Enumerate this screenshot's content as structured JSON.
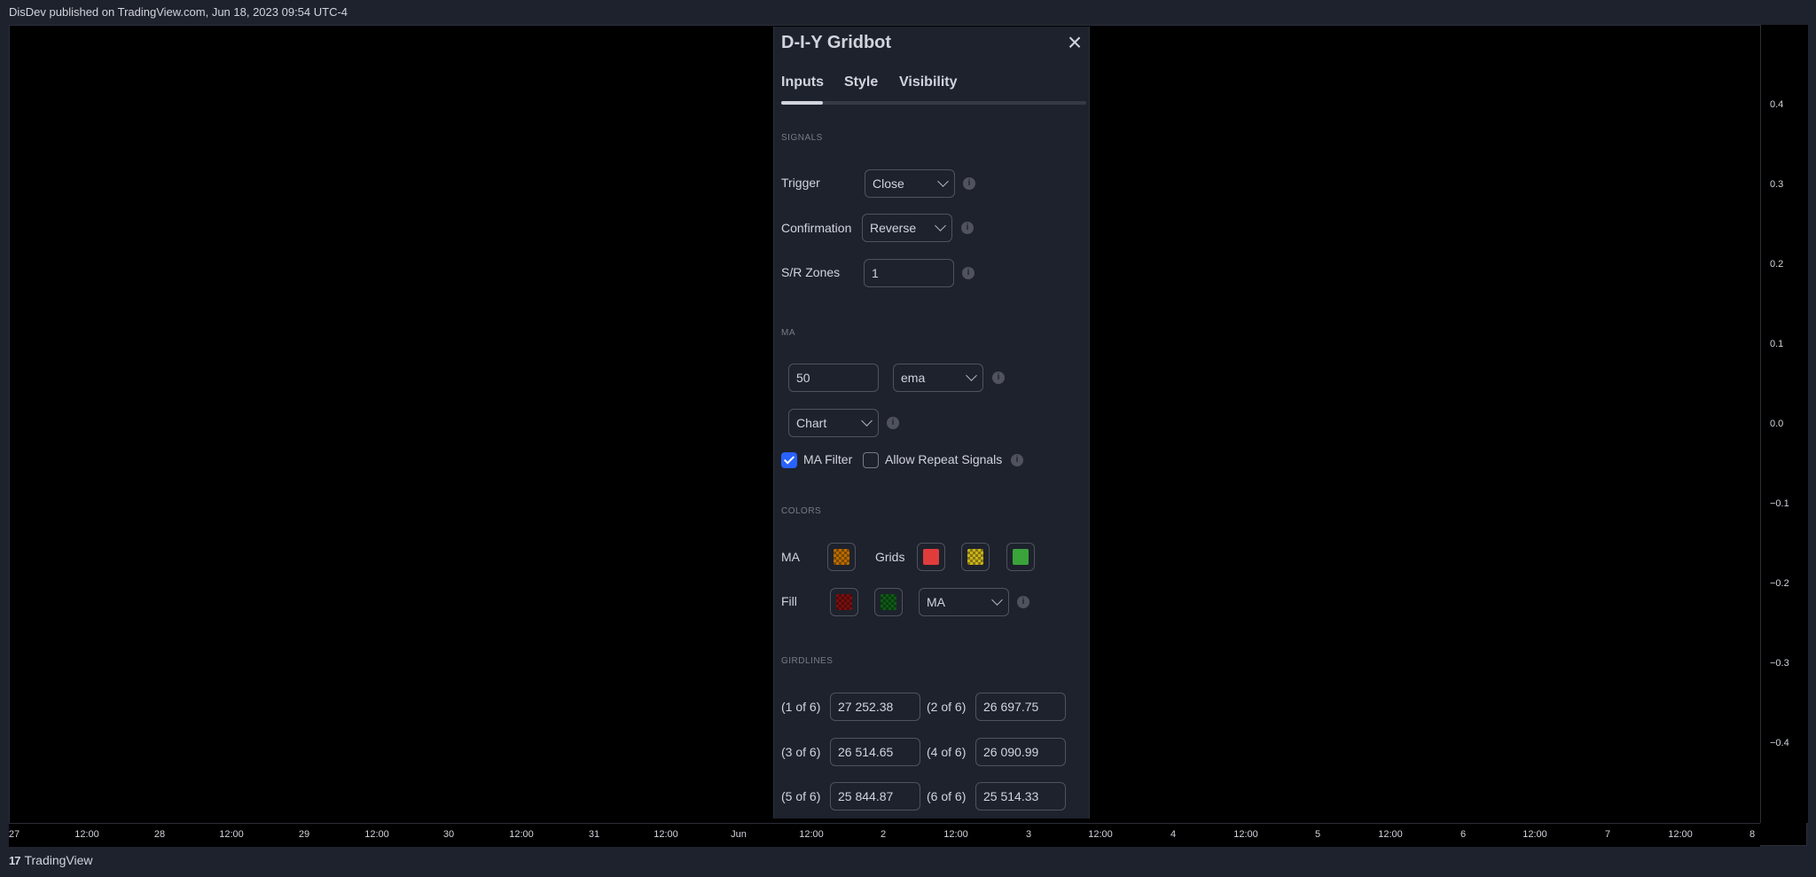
{
  "header": {
    "text": "DisDev published on TradingView.com, Jun 18, 2023 09:54 UTC-4"
  },
  "price_axis": {
    "ticks": [
      "0.4",
      "0.3",
      "0.2",
      "0.1",
      "0.0",
      "−0.1",
      "−0.2",
      "−0.3",
      "−0.4"
    ]
  },
  "time_axis": {
    "ticks": [
      "27",
      "12:00",
      "28",
      "12:00",
      "29",
      "12:00",
      "30",
      "12:00",
      "31",
      "12:00",
      "Jun",
      "12:00",
      "2",
      "12:00",
      "3",
      "12:00",
      "4",
      "12:00",
      "5",
      "12:00",
      "6",
      "12:00",
      "7",
      "12:00",
      "8"
    ]
  },
  "footer": {
    "logo": "17",
    "brand": "TradingView"
  },
  "dialog": {
    "title": "D-I-Y Gridbot",
    "close_icon": "×",
    "tabs": [
      {
        "label": "Inputs",
        "active": true
      },
      {
        "label": "Style"
      },
      {
        "label": "Visibility"
      }
    ],
    "signals": {
      "section": "SIGNALS",
      "trigger_label": "Trigger",
      "trigger_value": "Close",
      "confirmation_label": "Confirmation",
      "confirmation_value": "Reverse",
      "sr_label": "S/R Zones",
      "sr_value": "1"
    },
    "ma": {
      "section": "MA",
      "length": "50",
      "type": "ema",
      "source": "Chart",
      "ma_filter_label": "MA Filter",
      "ma_filter_checked": true,
      "allow_repeat_label": "Allow Repeat Signals",
      "allow_repeat_checked": false
    },
    "colors": {
      "section": "COLORS",
      "ma_label": "MA",
      "grids_label": "Grids",
      "fill_label": "Fill",
      "ma_color": "#b86b00",
      "grid_colors": [
        "#e03c3c",
        "#c9b21a",
        "#3aa33a"
      ],
      "fill_colors": [
        "#7a0f0f",
        "#0f5a18"
      ],
      "fill_mode": "MA"
    },
    "gridlines": {
      "section": "GIRDLINES",
      "items": [
        {
          "label": "(1 of 6)",
          "value": "27 252.38"
        },
        {
          "label": "(2 of 6)",
          "value": "26 697.75"
        },
        {
          "label": "(3 of 6)",
          "value": "26 514.65"
        },
        {
          "label": "(4 of 6)",
          "value": "26 090.99"
        },
        {
          "label": "(5 of 6)",
          "value": "25 844.87"
        },
        {
          "label": "(6 of 6)",
          "value": "25 514.33"
        }
      ]
    },
    "info_icon": "i"
  }
}
